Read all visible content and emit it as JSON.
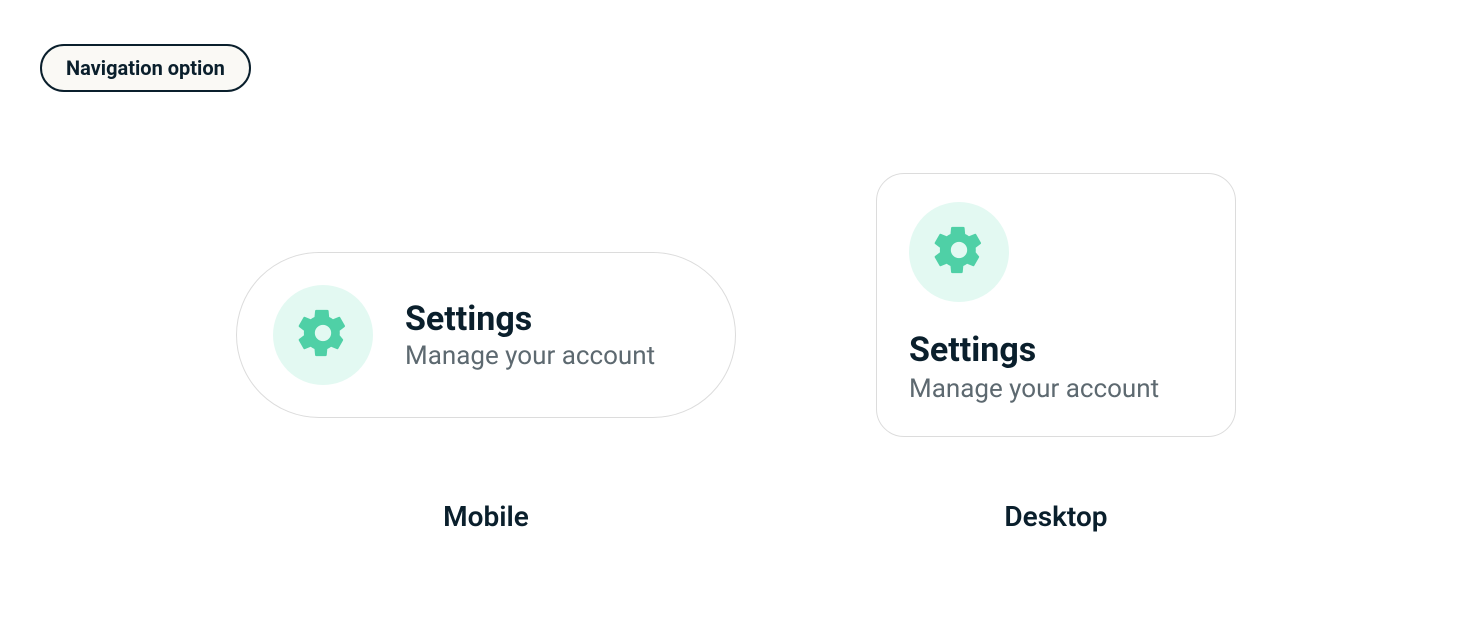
{
  "badge": {
    "label": "Navigation option"
  },
  "mobile": {
    "title": "Settings",
    "subtitle": "Manage your account",
    "caption": "Mobile"
  },
  "desktop": {
    "title": "Settings",
    "subtitle": "Manage your account",
    "caption": "Desktop"
  }
}
